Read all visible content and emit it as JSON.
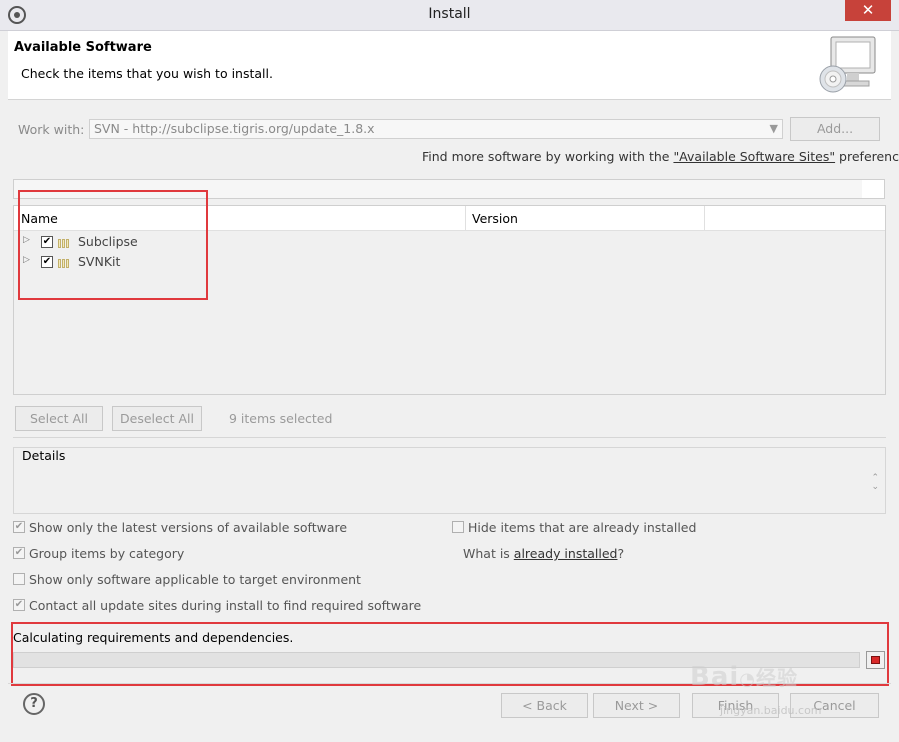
{
  "window": {
    "title": "Install",
    "close_glyph": "✕"
  },
  "header": {
    "title": "Available Software",
    "subtitle": "Check the items that you wish to install."
  },
  "work_with": {
    "label": "Work with:",
    "value": "SVN - http://subclipse.tigris.org/update_1.8.x",
    "add_label": "Add..."
  },
  "find_more": {
    "prefix": "Find more software by working with the ",
    "link": "\"Available Software Sites\"",
    "suffix": " preferences."
  },
  "tree": {
    "columns": [
      "Name",
      "Version"
    ],
    "items": [
      {
        "label": "Subclipse",
        "checked": true
      },
      {
        "label": "SVNKit",
        "checked": true
      }
    ]
  },
  "selection": {
    "select_all": "Select All",
    "deselect_all": "Deselect All",
    "count_text": "9 items selected"
  },
  "details": {
    "label": "Details"
  },
  "options": {
    "latest_versions": {
      "label": "Show only the latest versions of available software",
      "checked": true
    },
    "group_by_category": {
      "label": "Group items by category",
      "checked": true
    },
    "target_env": {
      "label": "Show only software applicable to target environment",
      "checked": false
    },
    "contact_sites": {
      "label": "Contact all update sites during install to find required software",
      "checked": true
    },
    "hide_installed": {
      "label": "Hide items that are already installed",
      "checked": false
    },
    "what_is_prefix": "What is ",
    "what_is_link": "already installed",
    "what_is_suffix": "?"
  },
  "status": {
    "text": "Calculating requirements and dependencies."
  },
  "footer": {
    "help": "?",
    "back": "< Back",
    "next": "Next >",
    "finish": "Finish",
    "cancel": "Cancel"
  },
  "watermark": {
    "main": "Bai",
    "cn": "经验",
    "sub": "jingyan.baidu.com"
  },
  "colors": {
    "highlight_box": "#e0393d",
    "close_button": "#c7423a",
    "stop_icon": "#d82828"
  }
}
